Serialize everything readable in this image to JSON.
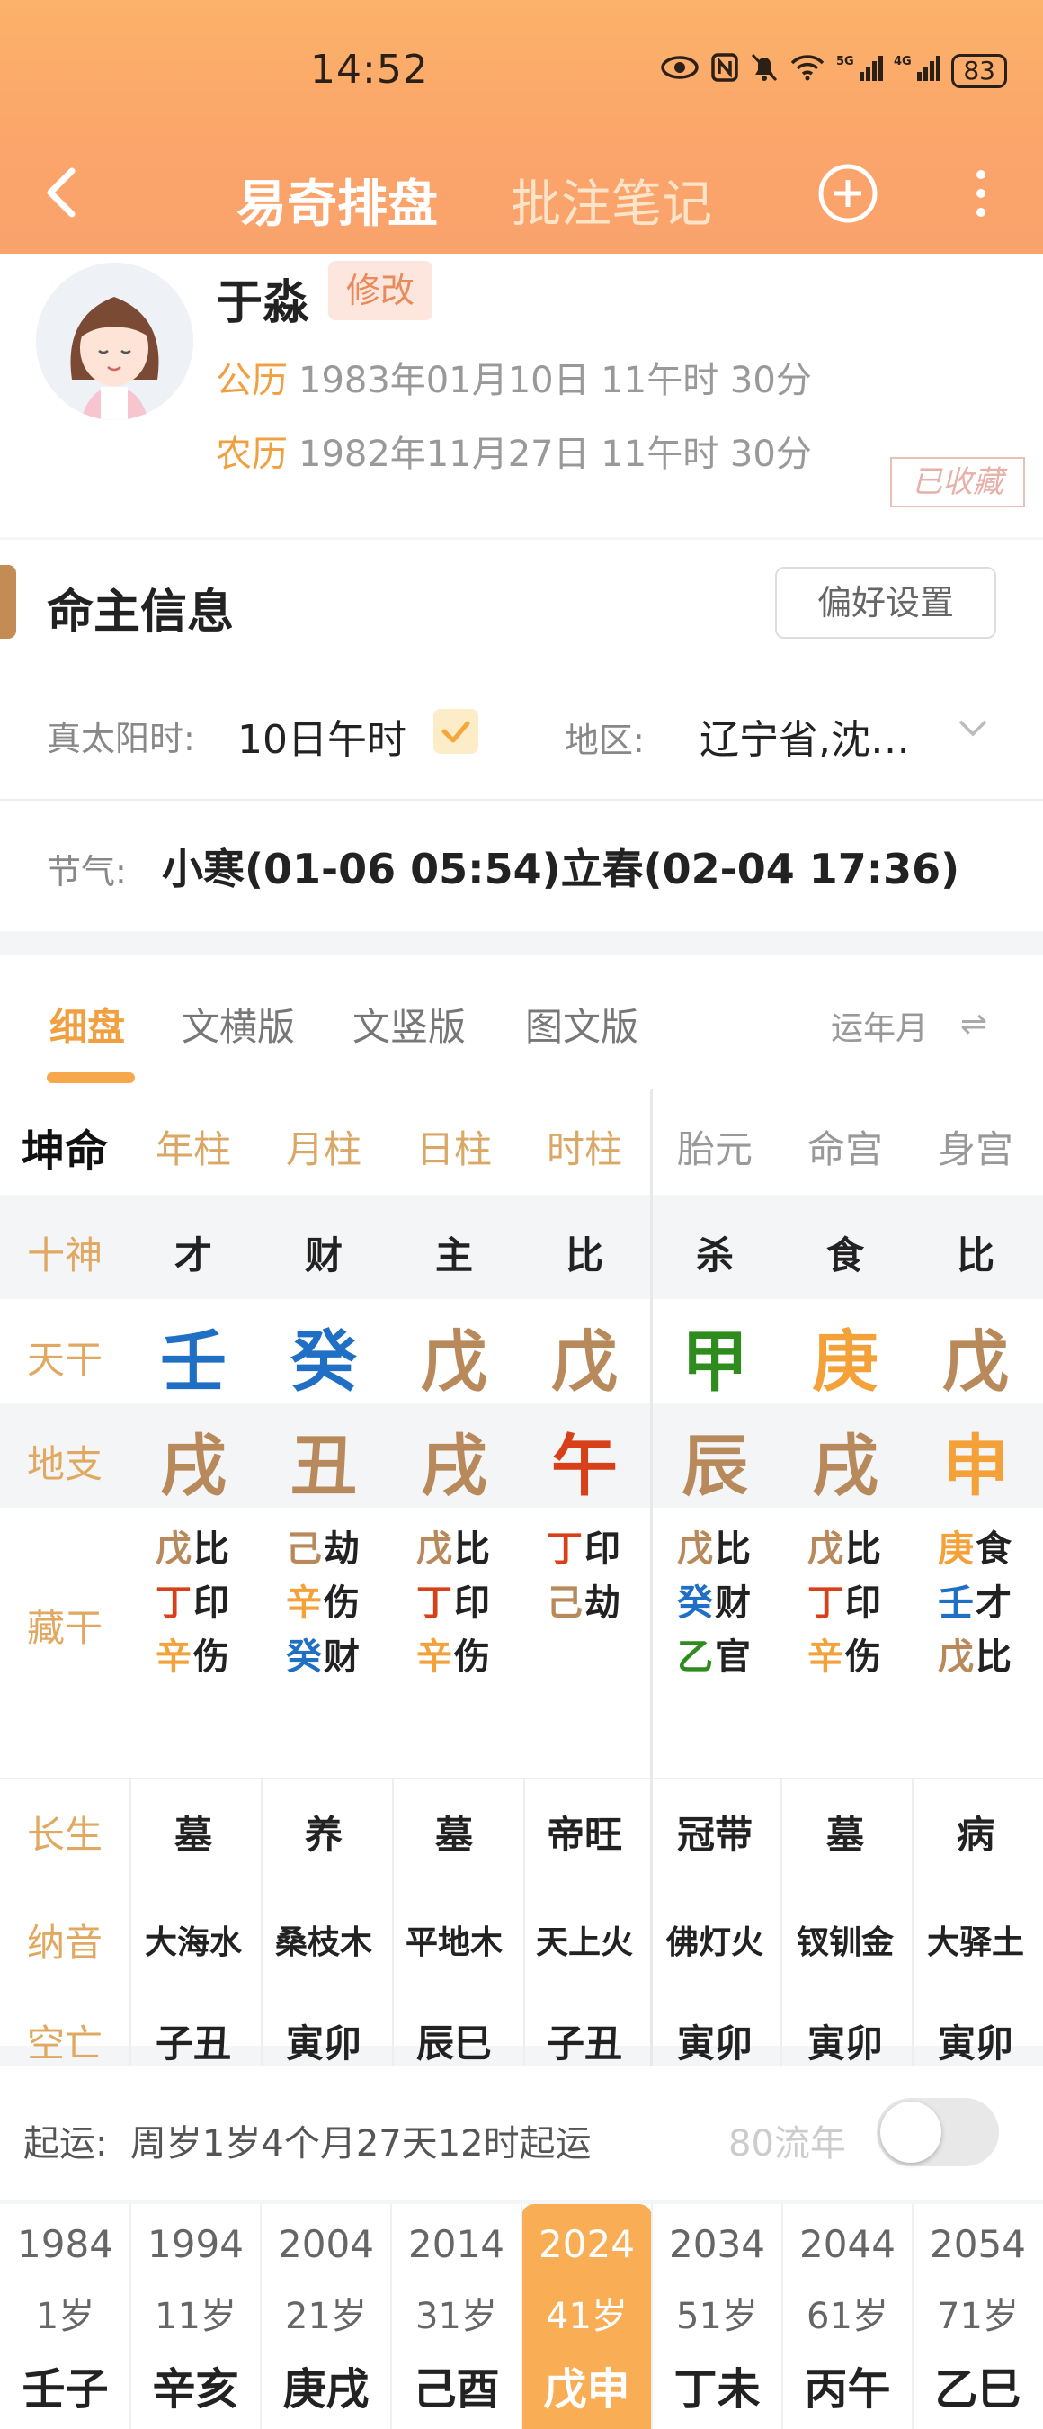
{
  "status_bar": {
    "time": "14:52",
    "battery": "83"
  },
  "nav": {
    "title": "易奇排盘",
    "second_tab": "批注笔记"
  },
  "profile": {
    "name": "于淼",
    "edit_label": "修改",
    "solar_label": "公历",
    "solar_date": "1983年01月10日 11午时 30分",
    "lunar_label": "农历",
    "lunar_date": "1982年11月27日 11午时 30分",
    "collected_stamp": "已收藏"
  },
  "owner_info": {
    "title": "命主信息",
    "preference_button": "偏好设置",
    "true_solar_label": "真太阳时:",
    "true_solar_value": "10日午时",
    "region_label": "地区:",
    "region_value": "辽宁省,沈…",
    "jieqi_label": "节气:",
    "jieqi_value": "小寒(01-06 05:54)立春(02-04 17:36)"
  },
  "view_tabs": [
    "细盘",
    "文横版",
    "文竖版",
    "图文版"
  ],
  "view_tab_active": "细盘",
  "yun_nian_yue": "运年月",
  "chart": {
    "gender_label": "坤命",
    "columns": [
      "年柱",
      "月柱",
      "日柱",
      "时柱",
      "胎元",
      "命宫",
      "身宫"
    ],
    "rows": {
      "shishen_label": "十神",
      "shishen": [
        "才",
        "财",
        "主",
        "比",
        "杀",
        "食",
        "比"
      ],
      "tiangan_label": "天干",
      "tiangan": [
        "壬",
        "癸",
        "戊",
        "戊",
        "甲",
        "庚",
        "戊"
      ],
      "dizhi_label": "地支",
      "dizhi": [
        "戌",
        "丑",
        "戌",
        "午",
        "辰",
        "戌",
        "申"
      ],
      "canggan_label": "藏干",
      "canggan": [
        [
          [
            "戊",
            "比"
          ],
          [
            "丁",
            "印"
          ],
          [
            "辛",
            "伤"
          ]
        ],
        [
          [
            "己",
            "劫"
          ],
          [
            "辛",
            "伤"
          ],
          [
            "癸",
            "财"
          ]
        ],
        [
          [
            "戊",
            "比"
          ],
          [
            "丁",
            "印"
          ],
          [
            "辛",
            "伤"
          ]
        ],
        [
          [
            "丁",
            "印"
          ],
          [
            "己",
            "劫"
          ]
        ],
        [
          [
            "戊",
            "比"
          ],
          [
            "癸",
            "财"
          ],
          [
            "乙",
            "官"
          ]
        ],
        [
          [
            "戊",
            "比"
          ],
          [
            "丁",
            "印"
          ],
          [
            "辛",
            "伤"
          ]
        ],
        [
          [
            "庚",
            "食"
          ],
          [
            "壬",
            "才"
          ],
          [
            "戊",
            "比"
          ]
        ]
      ],
      "changsheng_label": "长生",
      "changsheng": [
        "墓",
        "养",
        "墓",
        "帝旺",
        "冠带",
        "墓",
        "病"
      ],
      "nayin_label": "纳音",
      "nayin": [
        "大海水",
        "桑枝木",
        "平地木",
        "天上火",
        "佛灯火",
        "钗钏金",
        "大驿土"
      ],
      "kongwang_label": "空亡",
      "kongwang": [
        "子丑",
        "寅卯",
        "辰巳",
        "子丑",
        "寅卯",
        "寅卯",
        "寅卯"
      ]
    },
    "element_colors": {
      "water": "#1f6fc5",
      "wood": "#2e8b1e",
      "fire": "#d8401a",
      "earth": "#b8895a",
      "metal": "#f5a13a"
    }
  },
  "qiyun": {
    "label": "起运:",
    "text": "周岁1岁4个月27天12时起运",
    "liunian_label": "80流年",
    "liunian_enabled": false
  },
  "dayun": [
    {
      "year": "1984",
      "age": "1岁",
      "ganzhi": "壬子"
    },
    {
      "year": "1994",
      "age": "11岁",
      "ganzhi": "辛亥"
    },
    {
      "year": "2004",
      "age": "21岁",
      "ganzhi": "庚戌"
    },
    {
      "year": "2014",
      "age": "31岁",
      "ganzhi": "己酉"
    },
    {
      "year": "2024",
      "age": "41岁",
      "ganzhi": "戊申"
    },
    {
      "year": "2034",
      "age": "51岁",
      "ganzhi": "丁未"
    },
    {
      "year": "2044",
      "age": "61岁",
      "ganzhi": "丙午"
    },
    {
      "year": "2054",
      "age": "71岁",
      "ganzhi": "乙巳"
    }
  ],
  "dayun_active_index": 4
}
